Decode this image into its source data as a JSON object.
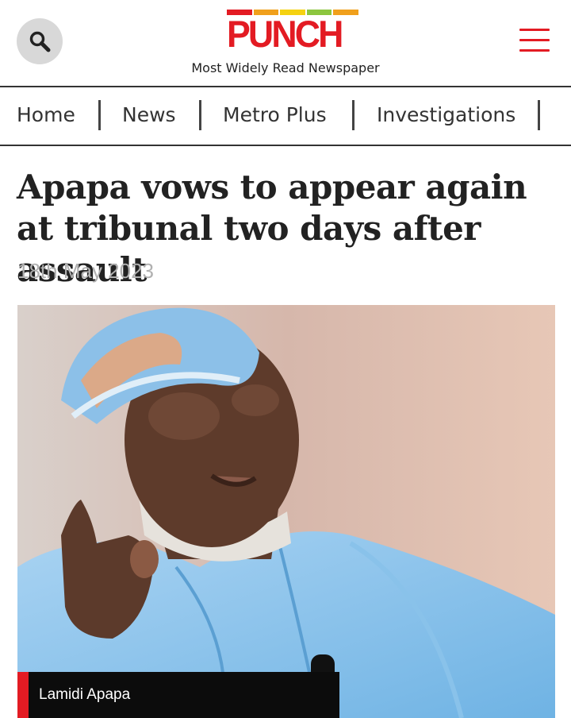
{
  "header": {
    "logo": "PUNCH",
    "tagline": "Most Widely Read Newspaper",
    "search_icon": "search-icon",
    "menu_icon": "hamburger-menu-icon",
    "logo_stripe_colors": [
      "#e31b23",
      "#f0a01c",
      "#f5d211",
      "#8cc63f",
      "#f0a01c"
    ]
  },
  "nav": {
    "items": [
      {
        "label": "Home"
      },
      {
        "label": "News"
      },
      {
        "label": "Metro Plus"
      },
      {
        "label": "Investigations"
      }
    ]
  },
  "article": {
    "title": "Apapa vows to appear again at tribunal two days after assault",
    "date": "18th May 2023",
    "photo_caption": "Lamidi Apapa"
  },
  "colors": {
    "brand_red": "#e31b23",
    "date_gray": "#b0b0b0"
  }
}
